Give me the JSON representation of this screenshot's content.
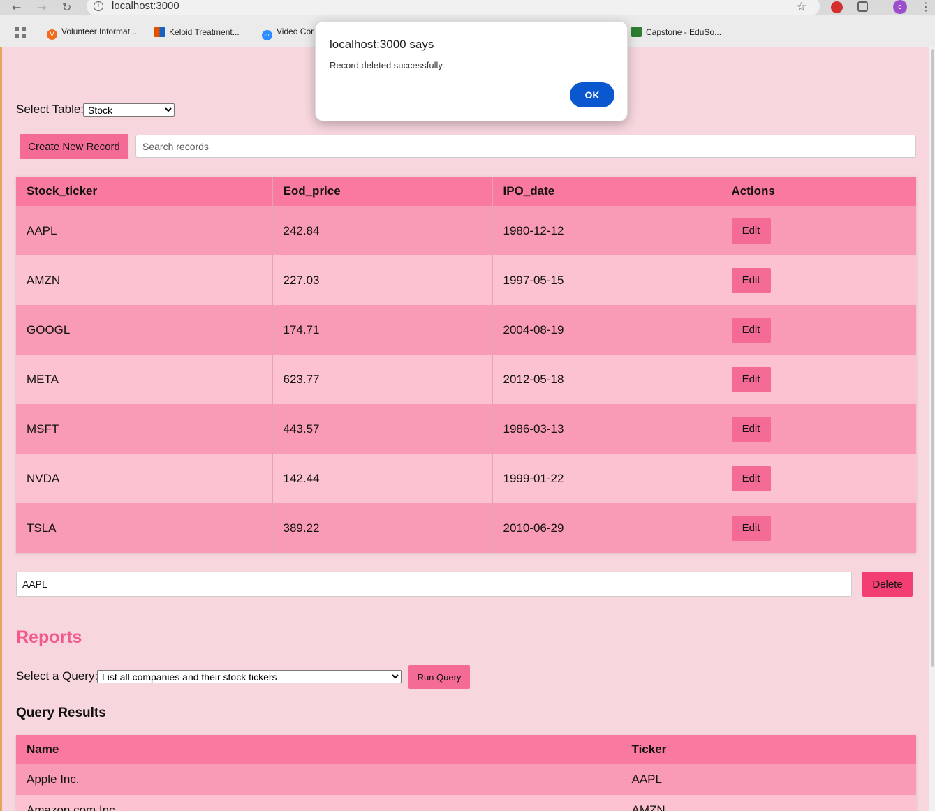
{
  "browser": {
    "url": "localhost:3000",
    "avatar_letter": "c",
    "bookmarks": [
      {
        "label": "Volunteer Informat...",
        "icon": "V",
        "color": "#f26b1d"
      },
      {
        "label": "Keloid Treatment...",
        "icon": "",
        "color": "#e65100"
      },
      {
        "label": "Video Cor",
        "icon": "zm",
        "color": "#2d8cff"
      },
      {
        "label": "Capstone - EduSo...",
        "icon": "",
        "color": "#2e7d32"
      }
    ]
  },
  "dialog": {
    "title": "localhost:3000 says",
    "message": "Record deleted successfully.",
    "ok_label": "OK"
  },
  "controls": {
    "select_table_label": "Select Table:",
    "selected_table": "Stock",
    "create_label": "Create New Record",
    "search_placeholder": "Search records"
  },
  "stock_table": {
    "headers": [
      "Stock_ticker",
      "Eod_price",
      "IPO_date",
      "Actions"
    ],
    "edit_label": "Edit",
    "rows": [
      [
        "AAPL",
        "242.84",
        "1980-12-12"
      ],
      [
        "AMZN",
        "227.03",
        "1997-05-15"
      ],
      [
        "GOOGL",
        "174.71",
        "2004-08-19"
      ],
      [
        "META",
        "623.77",
        "2012-05-18"
      ],
      [
        "MSFT",
        "443.57",
        "1986-03-13"
      ],
      [
        "NVDA",
        "142.44",
        "1999-01-22"
      ],
      [
        "TSLA",
        "389.22",
        "2010-06-29"
      ]
    ]
  },
  "delete": {
    "input_value": "AAPL",
    "button_label": "Delete"
  },
  "reports": {
    "title": "Reports",
    "query_label": "Select a Query:",
    "selected_query": "List all companies and their stock tickers",
    "run_label": "Run Query",
    "results_title": "Query Results",
    "headers": [
      "Name",
      "Ticker"
    ],
    "rows": [
      [
        "Apple Inc.",
        "AAPL"
      ],
      [
        "Amazon.com Inc.",
        "AMZN"
      ]
    ]
  }
}
